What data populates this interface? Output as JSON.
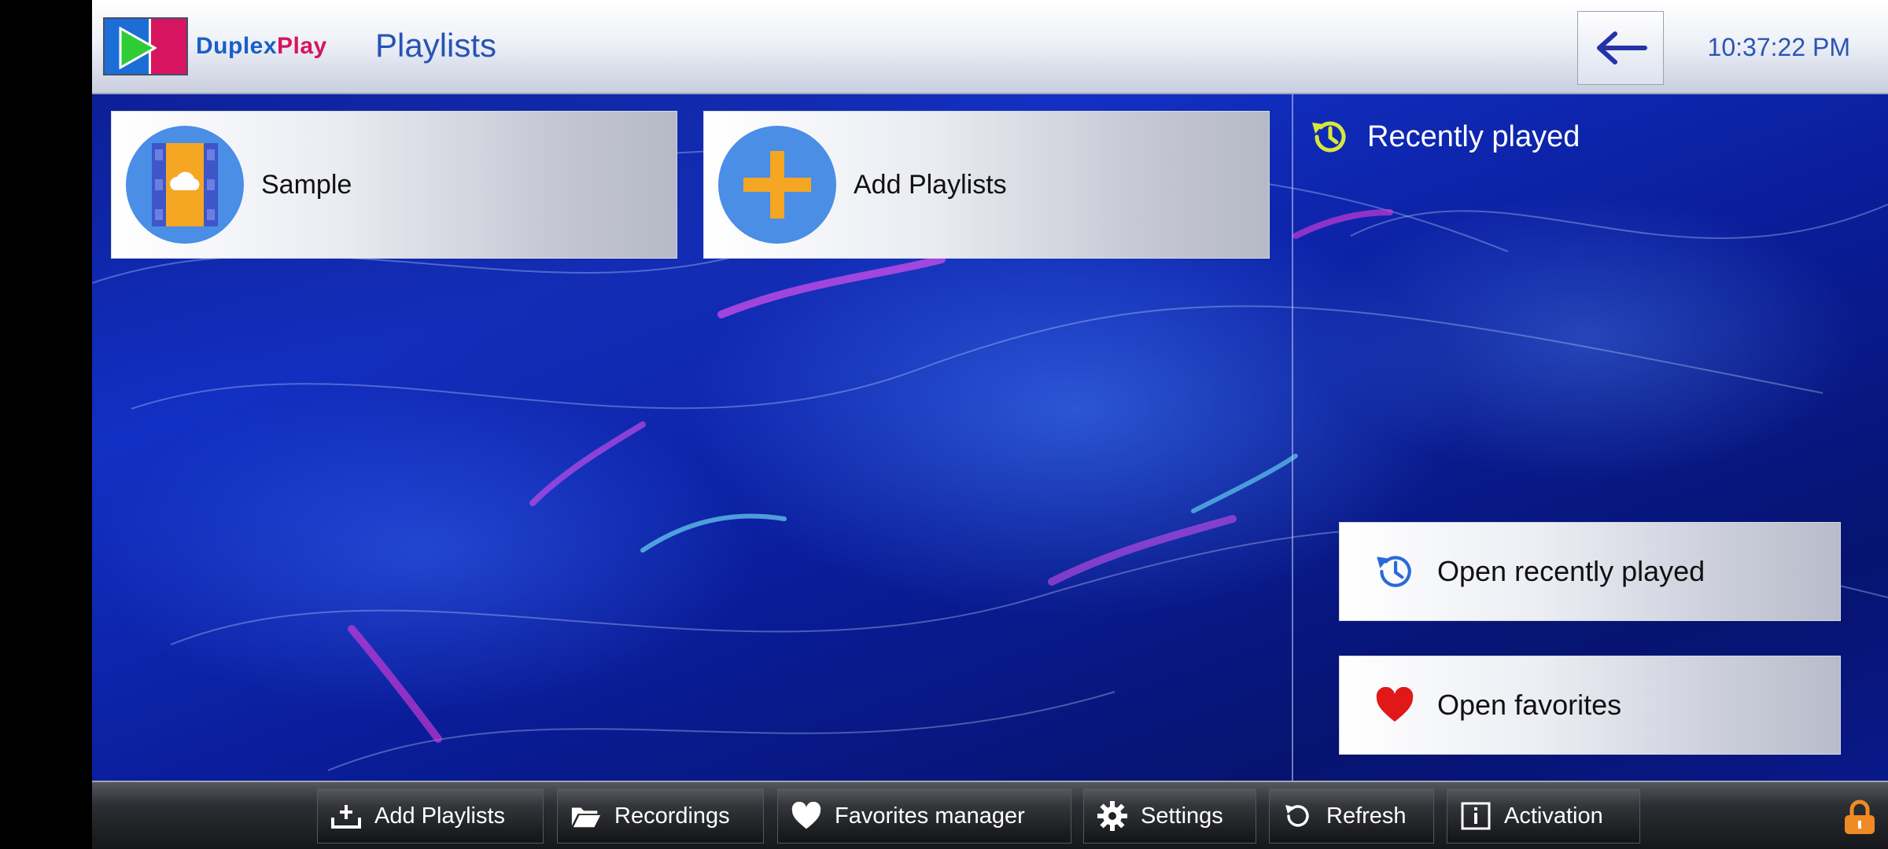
{
  "header": {
    "brand_part1": "Duplex",
    "brand_part2": "Play",
    "title": "Playlists",
    "back_icon": "arrow-left-icon",
    "clock": "10:37:22 PM"
  },
  "playlists": [
    {
      "label": "Sample",
      "icon": "film-cloud-icon"
    },
    {
      "label": "Add Playlists",
      "icon": "plus-icon"
    }
  ],
  "recent": {
    "heading": "Recently played",
    "heading_icon": "history-icon",
    "open_recent_label": "Open recently played",
    "open_favorites_label": "Open favorites"
  },
  "bottombar": {
    "items": [
      {
        "label": "Add Playlists",
        "icon": "add-tray-icon"
      },
      {
        "label": "Recordings",
        "icon": "folder-open-icon"
      },
      {
        "label": "Favorites manager",
        "icon": "heart-icon"
      },
      {
        "label": "Settings",
        "icon": "gear-icon"
      },
      {
        "label": "Refresh",
        "icon": "refresh-icon"
      },
      {
        "label": "Activation",
        "icon": "info-icon"
      }
    ],
    "lock_icon": "lock-icon"
  },
  "colors": {
    "brand_blue": "#1a5fc6",
    "brand_pink": "#d7145f",
    "history_yellow": "#d8e83a",
    "heart_red": "#e01818",
    "tile_circle": "#4a8ee6",
    "plus_orange": "#f5a623"
  }
}
